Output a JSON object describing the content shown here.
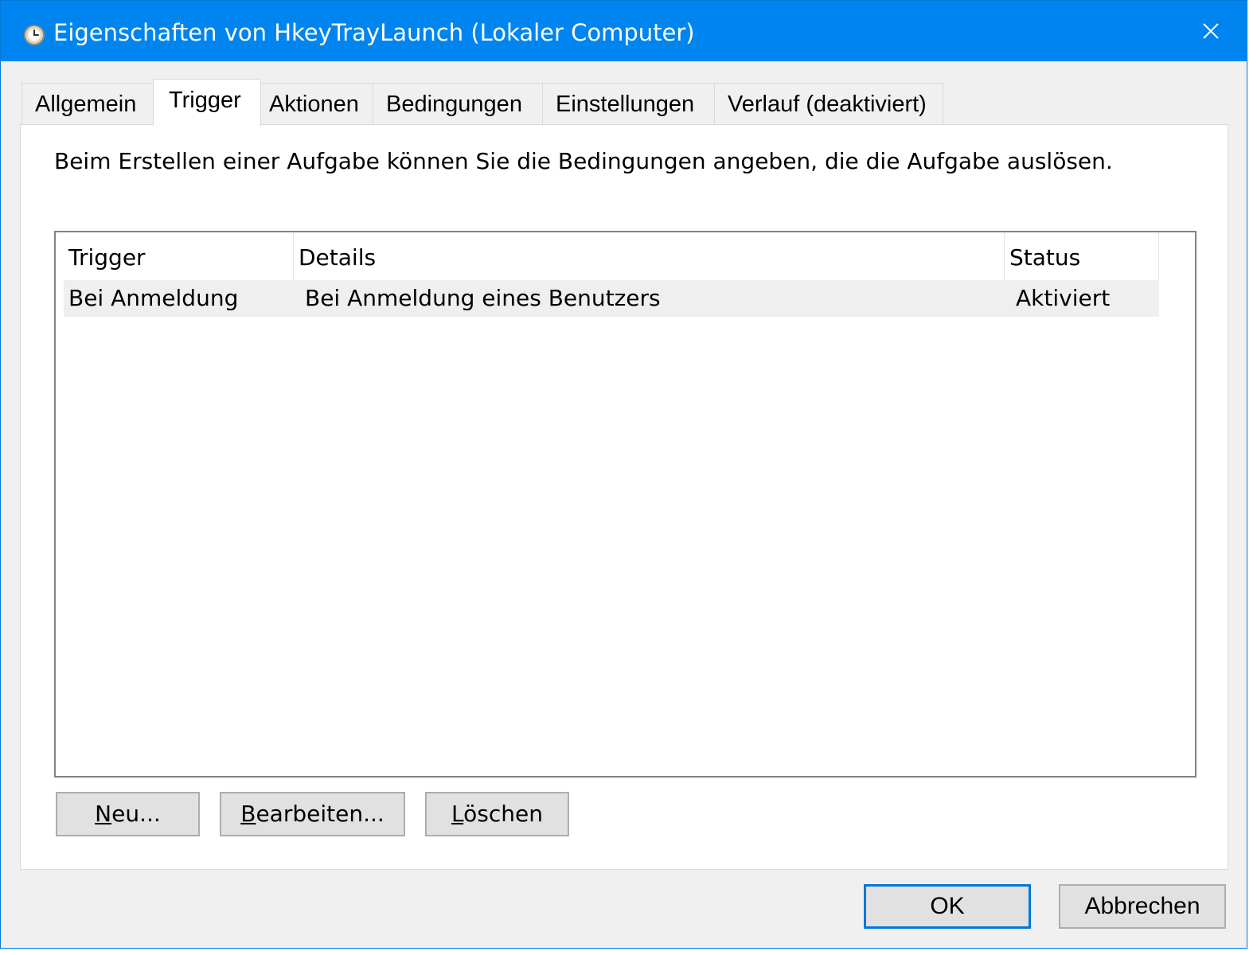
{
  "window": {
    "title": "Eigenschaften von HkeyTrayLaunch (Lokaler Computer)",
    "titlebar_color": "#0085f0",
    "accent_color": "#0078d7"
  },
  "tabs": [
    {
      "label": "Allgemein",
      "active": false
    },
    {
      "label": "Trigger",
      "active": true
    },
    {
      "label": "Aktionen",
      "active": false
    },
    {
      "label": "Bedingungen",
      "active": false
    },
    {
      "label": "Einstellungen",
      "active": false
    },
    {
      "label": "Verlauf (deaktiviert)",
      "active": false
    }
  ],
  "panel": {
    "description": "Beim Erstellen einer Aufgabe können Sie die Bedingungen angeben, die die Aufgabe auslösen."
  },
  "list": {
    "columns": [
      "Trigger",
      "Details",
      "Status"
    ],
    "rows": [
      {
        "trigger": "Bei Anmeldung",
        "details": "Bei Anmeldung eines Benutzers",
        "status": "Aktiviert"
      }
    ]
  },
  "buttons": {
    "new": {
      "accel": "N",
      "rest": "eu..."
    },
    "edit": {
      "accel": "B",
      "rest": "earbeiten..."
    },
    "delete": {
      "accel": "L",
      "rest": "öschen"
    },
    "ok": "OK",
    "cancel": "Abbrechen"
  }
}
